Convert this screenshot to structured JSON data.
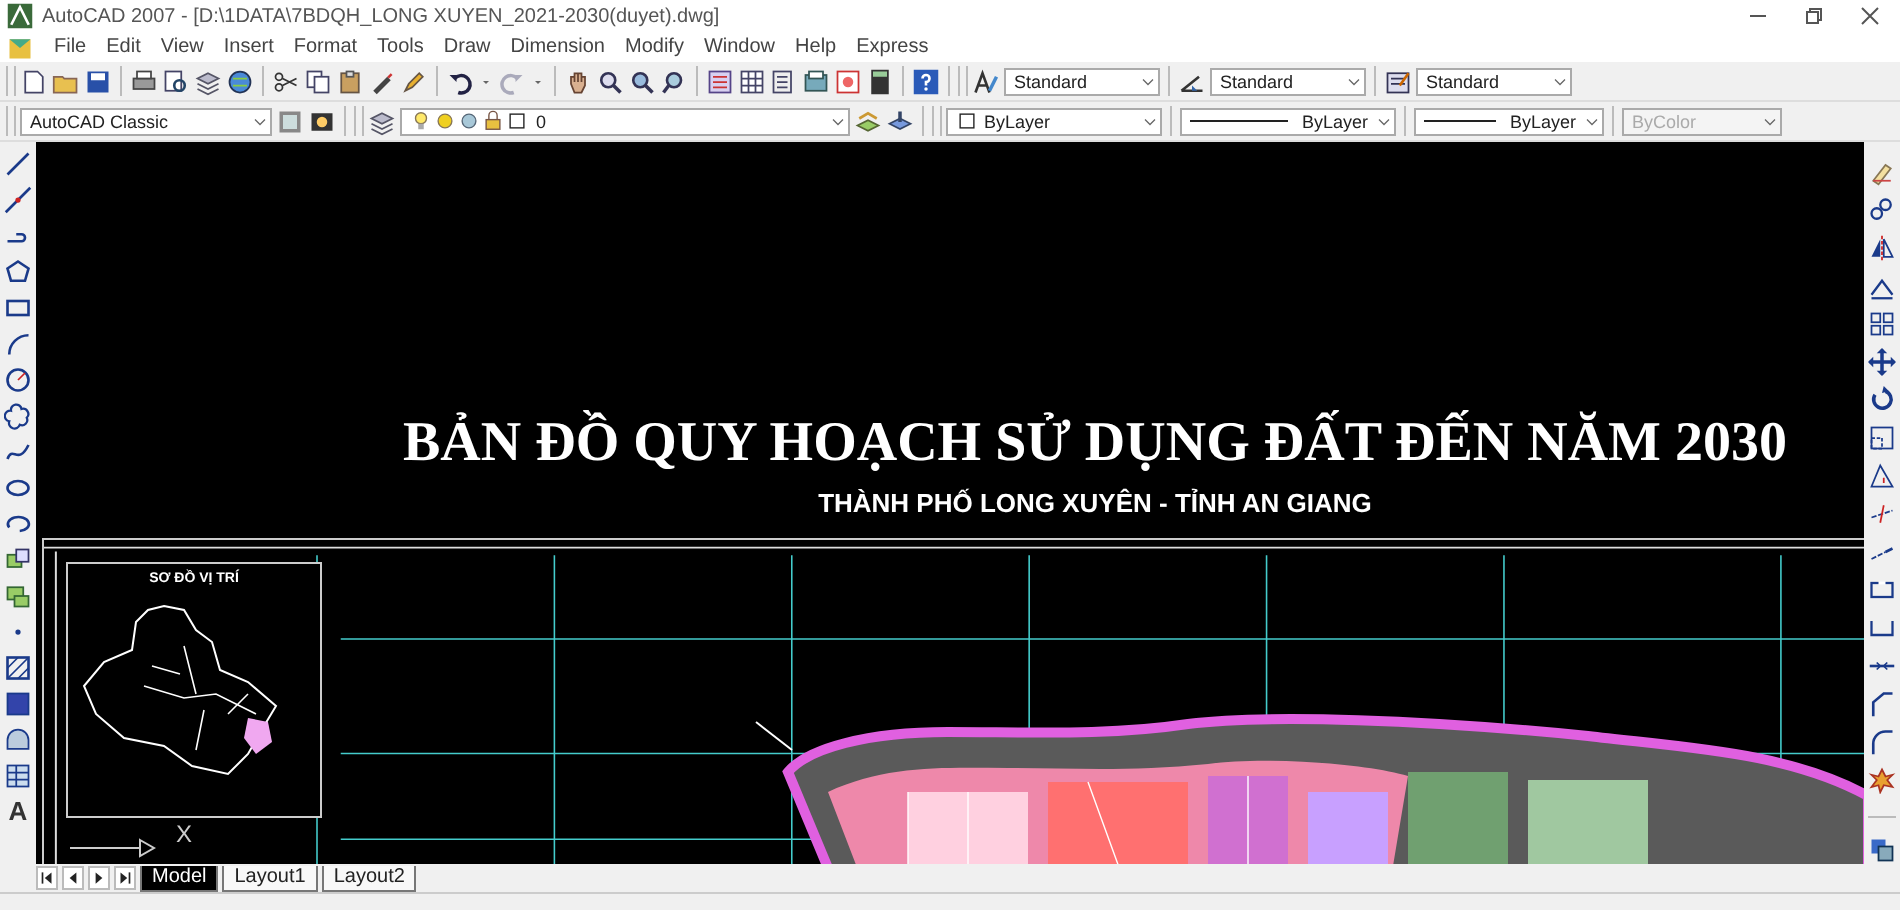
{
  "window": {
    "title": "AutoCAD 2007 - [D:\\1DATA\\7BDQH_LONG XUYEN_2021-2030(duyet).dwg]"
  },
  "menu": [
    "File",
    "Edit",
    "View",
    "Insert",
    "Format",
    "Tools",
    "Draw",
    "Dimension",
    "Modify",
    "Window",
    "Help",
    "Express"
  ],
  "styles_toolbar": {
    "text_style": "Standard",
    "dimension_style": "Standard",
    "table_style": "Standard"
  },
  "workspace": {
    "value": "AutoCAD Classic"
  },
  "layer": {
    "value": "0"
  },
  "properties": {
    "color_setting": "ByLayer",
    "linetype": "ByLayer",
    "lineweight": "ByLayer",
    "plot_style": {
      "value": "ByColor",
      "disabled": true
    }
  },
  "draw_toolbar": {
    "text_tool": "A"
  },
  "drawing": {
    "title": "BẢN ĐỒ QUY HOẠCH SỬ DỤNG ĐẤT ĐẾN NĂM 2030",
    "subtitle": "THÀNH PHỐ LONG XUYÊN - TỈNH AN GIANG",
    "inset_title": "SƠ ĐỒ VỊ TRÍ",
    "ucs_label": "X"
  },
  "layout_tabs": [
    {
      "label": "Model",
      "selected": true
    },
    {
      "label": "Layout1",
      "selected": false
    },
    {
      "label": "Layout2",
      "selected": false
    }
  ]
}
